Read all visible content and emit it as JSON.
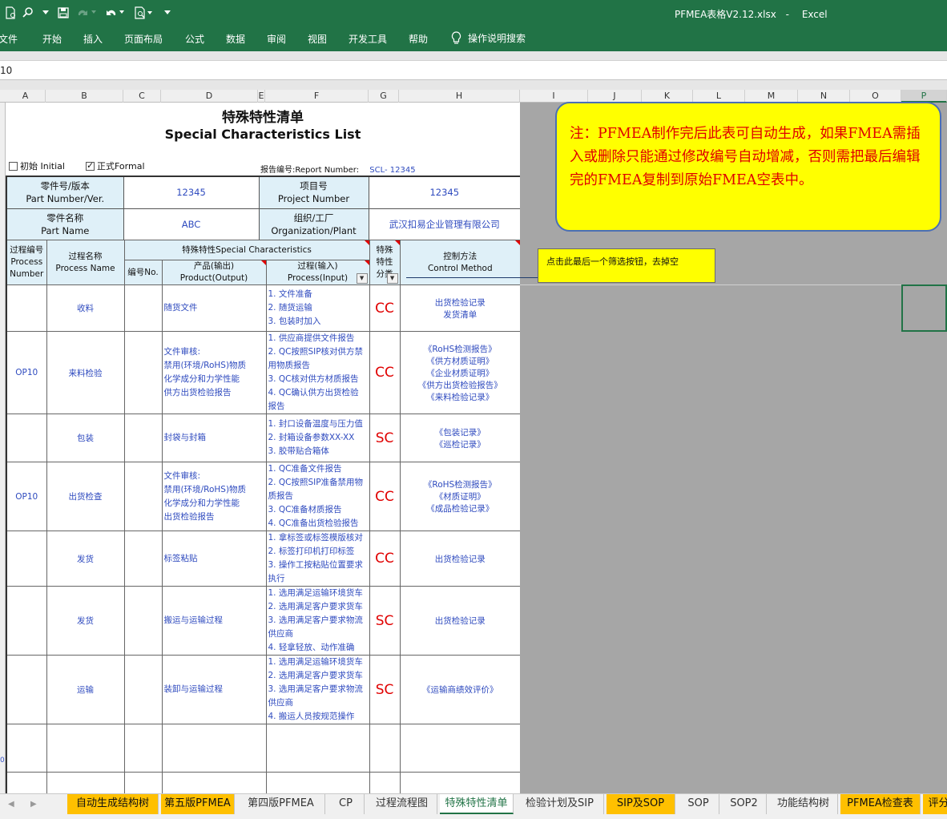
{
  "app": {
    "file": "PFMEA表格V2.12.xlsx",
    "separator": "-",
    "name": "Excel"
  },
  "ribbon_tabs": [
    "文件",
    "开始",
    "插入",
    "页面布局",
    "公式",
    "数据",
    "审阅",
    "视图",
    "开发工具",
    "帮助"
  ],
  "tell_me": "操作说明搜索",
  "name_box": "10",
  "columns": [
    "A",
    "B",
    "C",
    "D",
    "E",
    "F",
    "G",
    "H",
    "I",
    "J",
    "K",
    "L",
    "M",
    "N",
    "O",
    "P"
  ],
  "sheet": {
    "title": "特殊特性清单",
    "subtitle": "Special Characteristics List",
    "checkbox_initial": "初始 Initial",
    "checkbox_formal": "正式Formal",
    "report_label": "报告编号:Report Number:",
    "report_value": "SCL- 12345",
    "info": {
      "part_label_cn": "零件号/版本",
      "part_label_en": "Part Number/Ver.",
      "part_value": "12345",
      "project_label_cn": "项目号",
      "project_label_en": "Project Number",
      "project_value": "12345",
      "name_label_cn": "零件名称",
      "name_label_en": "Part Name",
      "name_value": "ABC",
      "org_label_cn": "组织/工厂",
      "org_label_en": "Organization/Plant",
      "org_value": "武汉扣易企业管理有限公司"
    },
    "headers": {
      "proc_num_cn": "过程编号",
      "proc_num_en1": "Process",
      "proc_num_en2": "Number",
      "proc_name_cn": "过程名称",
      "proc_name_en": "Process Name",
      "sc": "特殊特性Special Characteristics",
      "num": "编号No.",
      "product_cn": "产品(输出)",
      "product_en": "Product(Output)",
      "process_cn": "过程(输入)",
      "process_en": "Process(Input)",
      "class1": "特殊",
      "class2": "特性",
      "class3": "分类",
      "control_cn": "控制方法",
      "control_en": "Control Method"
    },
    "rows": [
      {
        "num": "",
        "name": "收料",
        "product": "随货文件",
        "process": [
          "1. 文件准备",
          "2. 随货运输",
          "3. 包装时加入"
        ],
        "cls": "CC",
        "control": [
          "出货检验记录",
          "发货清单"
        ]
      },
      {
        "num": "OP10",
        "name": "来料检验",
        "product": "文件审核:\n禁用(环境/RoHS)物质\n化学成分和力学性能\n供方出货检验报告",
        "process": [
          "1. 供应商提供文件报告",
          "2. QC按照SIP核对供方禁",
          "用物质报告",
          "3. QC核对供方材质报告",
          "4. QC确认供方出货检验",
          "报告"
        ],
        "cls": "CC",
        "control": [
          "《RoHS检测报告》",
          "《供方材质证明》",
          "《企业材质证明》",
          "《供方出货检验报告》",
          "《来料检验记录》"
        ]
      },
      {
        "num": "",
        "name": "包装",
        "product": "封袋与封箱",
        "process": [
          "1. 封口设备温度与压力值",
          "2. 封箱设备参数XX-XX",
          "3. 胶带贴合箱体"
        ],
        "cls": "SC",
        "control": [
          "《包装记录》",
          "《巡检记录》"
        ]
      },
      {
        "num": "OP10",
        "name": "出货检查",
        "product": "文件审核:\n禁用(环境/RoHS)物质\n化学成分和力学性能\n出货检验报告",
        "process": [
          "1. QC准备文件报告",
          "2. QC按照SIP准备禁用物",
          "质报告",
          "3. QC准备材质报告",
          "4. QC准备出货检验报告"
        ],
        "cls": "CC",
        "control": [
          "《RoHS检测报告》",
          "《材质证明》",
          "《成品检验记录》"
        ]
      },
      {
        "num": "",
        "name": "发货",
        "product": "标签粘贴",
        "process": [
          "1. 拿标签或标签模版核对",
          "2. 标签打印机打印标签",
          "3. 操作工按粘贴位置要求",
          "执行"
        ],
        "cls": "CC",
        "control": [
          "出货检验记录"
        ]
      },
      {
        "num": "",
        "name": "发货",
        "product": "搬运与运输过程",
        "process": [
          "1. 选用满足运输环境货车",
          "2. 选用满足客户要求货车",
          "3. 选用满足客户要求物流",
          "供应商",
          "4. 轻拿轻放、动作准确"
        ],
        "cls": "SC",
        "control": [
          "出货检验记录"
        ]
      },
      {
        "num": "",
        "name": "运输",
        "product": "装卸与运输过程",
        "process": [
          "1. 选用满足运输环境货车",
          "2. 选用满足客户要求货车",
          "3. 选用满足客户要求物流",
          "供应商",
          "4. 搬运人员按规范操作"
        ],
        "cls": "SC",
        "control": [
          "《运输商绩效评价》"
        ]
      }
    ]
  },
  "row_number_partial": "0",
  "note": "注：PFMEA制作完后此表可自动生成，如果FMEA需插入或删除只能通过修改编号自动增减，否则需把最后编辑完的FMEA复制到原始FMEA空表中。",
  "callout": "点击此最后一个筛选按钮，去掉空",
  "sheet_tabs": [
    {
      "label": "自动生成结构树",
      "style": "orange"
    },
    {
      "label": "第五版PFMEA",
      "style": "orange"
    },
    {
      "label": "第四版PFMEA",
      "style": "normal"
    },
    {
      "label": "CP",
      "style": "normal"
    },
    {
      "label": "过程流程图",
      "style": "normal"
    },
    {
      "label": "特殊特性清单",
      "style": "active"
    },
    {
      "label": "检验计划及SIP",
      "style": "normal"
    },
    {
      "label": "SIP及SOP",
      "style": "orange"
    },
    {
      "label": "SOP",
      "style": "normal"
    },
    {
      "label": "SOP2",
      "style": "normal"
    },
    {
      "label": "功能结构树",
      "style": "normal"
    },
    {
      "label": "PFMEA检查表",
      "style": "orange"
    },
    {
      "label": "评分",
      "style": "orange"
    }
  ],
  "colors": {
    "excel_green": "#217346",
    "header_fill": "#dff0f8",
    "value_blue": "#2f4bbf",
    "class_red": "#e00000",
    "note_yellow": "#ffff00",
    "tab_orange": "#ffc000"
  }
}
